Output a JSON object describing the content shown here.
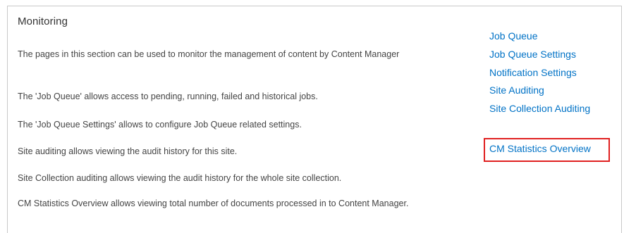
{
  "section": {
    "title": "Monitoring",
    "descriptions": [
      "The pages in this section can be used to monitor the management of content by Content Manager",
      "The 'Job Queue' allows access to pending, running, failed and historical jobs.",
      "The 'Job Queue Settings' allows to configure Job Queue related settings.",
      "Site auditing allows viewing the audit history for this site.",
      "Site Collection auditing allows viewing the audit history for the whole site collection.",
      "CM Statistics Overview allows viewing total number of documents processed in to Content Manager."
    ]
  },
  "links": [
    "Job Queue",
    "Job Queue Settings",
    "Notification Settings",
    "Site Auditing",
    "Site Collection Auditing",
    "CM Statistics Overview"
  ],
  "colors": {
    "link": "#0072c6",
    "highlight_border": "#e02020",
    "text": "#444444"
  }
}
